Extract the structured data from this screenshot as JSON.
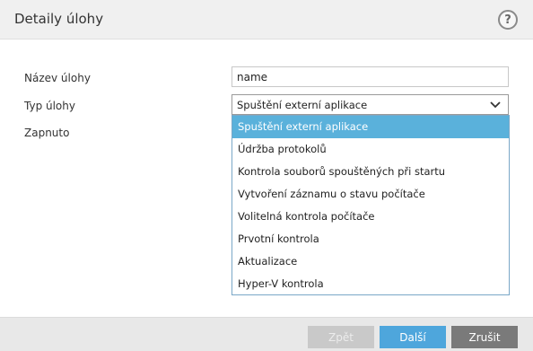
{
  "header": {
    "title": "Detaily úlohy",
    "help_label": "?"
  },
  "form": {
    "name_label": "Název úlohy",
    "name_value": "name",
    "type_label": "Typ úlohy",
    "type_selected": "Spuštění externí aplikace",
    "enabled_label": "Zapnuto"
  },
  "dropdown": {
    "items": [
      "Spuštění externí aplikace",
      "Údržba protokolů",
      "Kontrola souborů spouštěných při startu",
      "Vytvoření záznamu o stavu počítače",
      "Volitelná kontrola počítače",
      "Prvotní kontrola",
      "Aktualizace",
      "Hyper-V kontrola"
    ],
    "selected_index": 0
  },
  "footer": {
    "back_label": "Zpět",
    "next_label": "Další",
    "cancel_label": "Zrušit"
  },
  "colors": {
    "highlight": "#5ab1db",
    "primary_button": "#4ea6dc",
    "cancel_button": "#7a7a7a",
    "disabled_button": "#c9c9c9"
  }
}
